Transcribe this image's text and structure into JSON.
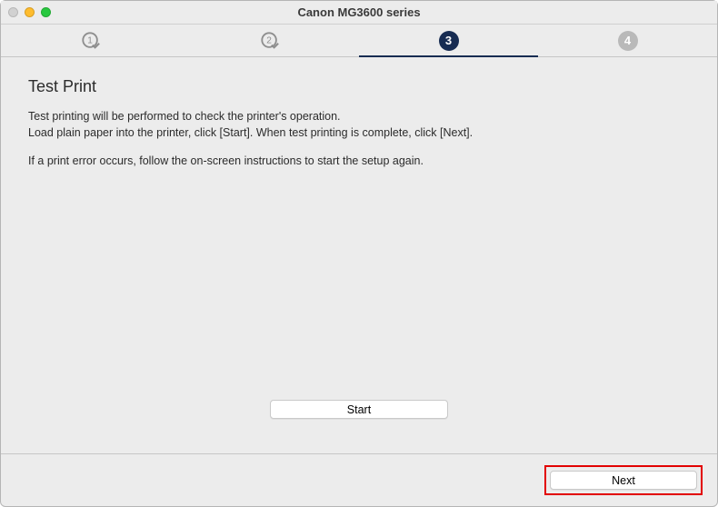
{
  "window": {
    "title": "Canon MG3600 series"
  },
  "stepper": {
    "steps": [
      {
        "label": "1",
        "state": "completed"
      },
      {
        "label": "2",
        "state": "completed"
      },
      {
        "label": "3",
        "state": "active"
      },
      {
        "label": "4",
        "state": "pending"
      }
    ]
  },
  "page": {
    "heading": "Test Print",
    "para1": "Test printing will be performed to check the printer's operation.\nLoad plain paper into the printer, click [Start]. When test printing is complete, click [Next].",
    "para2": "If a print error occurs, follow the on-screen instructions to start the setup again."
  },
  "buttons": {
    "start": "Start",
    "next": "Next"
  }
}
